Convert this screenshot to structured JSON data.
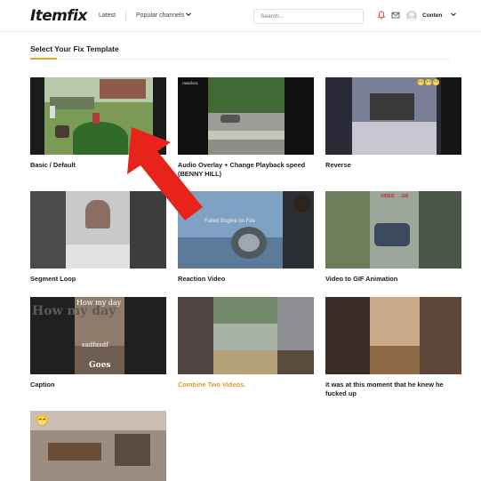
{
  "header": {
    "logo": "Itemfix",
    "nav_latest": "Latest",
    "nav_popular": "Popular channels",
    "search_placeholder": "Search...",
    "user_name": "Conten"
  },
  "section": {
    "title": "Select Your Fix Template"
  },
  "templates": [
    {
      "label": "Basic / Default"
    },
    {
      "label": "Audio Overlay + Change Playback speed (BENNY HILL)",
      "thumb_watermark": "rawafora"
    },
    {
      "label": "Reverse",
      "thumb_emojis": "😬😬😬"
    },
    {
      "label": "Segment Loop"
    },
    {
      "label": "Reaction Video",
      "thumb_overlay": "Failed Engine on Fire"
    },
    {
      "label": "Video to GIF Animation",
      "thumb_overlay": "VIDEO → GIF"
    },
    {
      "label": "Caption",
      "thumb_top": "How my day",
      "thumb_top_bg": "How my day",
      "thumb_mid": "sadfasdf",
      "thumb_bottom": "Goes"
    },
    {
      "label": "Combine Two Videos.",
      "highlighted": true
    },
    {
      "label": "it was at this moment that he knew he fucked up"
    },
    {
      "label": "",
      "thumb_emoji": "😁"
    }
  ],
  "colors": {
    "accent": "#f0a020",
    "highlight_link": "#e09a2a",
    "annotation_arrow": "#e8231a"
  }
}
